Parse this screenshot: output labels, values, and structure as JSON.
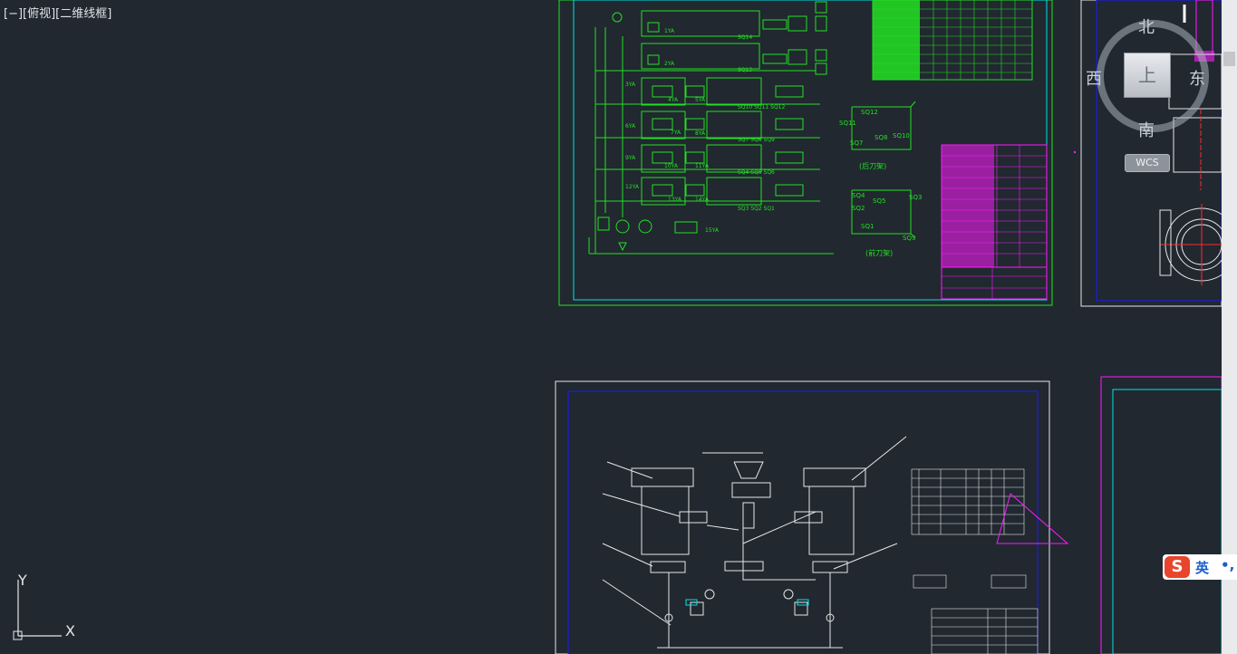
{
  "viewport": {
    "label": "[−][俯视][二维线框]"
  },
  "viewcube": {
    "north": "北",
    "south": "南",
    "east": "东",
    "west": "西",
    "face": "上",
    "wcs": "WCS"
  },
  "ucs": {
    "x": "X",
    "y": "Y"
  },
  "drawing1": {
    "labels": [
      "1YA",
      "2YA",
      "3YA",
      "4YA",
      "5YA",
      "6YA",
      "7YA",
      "8YA",
      "9YA",
      "10YA",
      "11YA",
      "12YA",
      "13YA",
      "14YA",
      "15YA"
    ],
    "switches": [
      "SQ14",
      "SQ13",
      "SQ10",
      "SQ11",
      "SQ12",
      "SQ7",
      "SQ8",
      "SQ9",
      "SQ4",
      "SQ5",
      "SQ6",
      "SQ1",
      "SQ2",
      "SQ3"
    ],
    "rear_title": "(后刀架)",
    "front_title": "(前刀架)",
    "colors": {
      "green": "#22e022",
      "magenta": "#ff1aff",
      "white": "#ffffff",
      "blue": "#1a1aff",
      "cyan": "#00e5e5"
    }
  },
  "ime": {
    "lang": "英",
    "punct": "•,"
  }
}
